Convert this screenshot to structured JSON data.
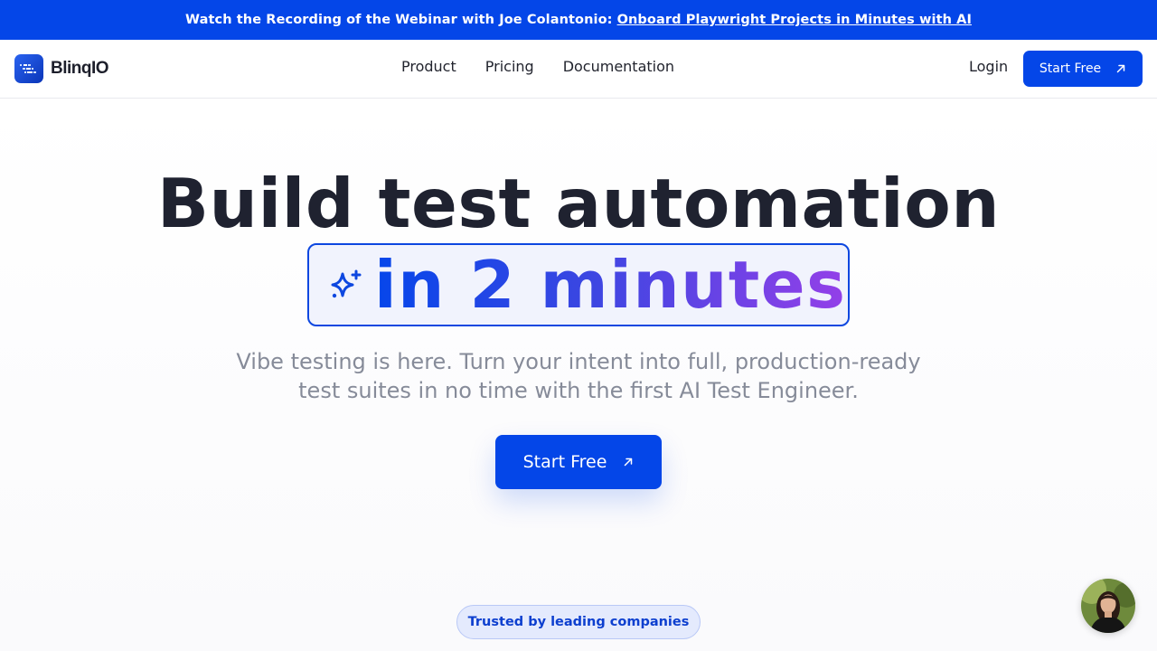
{
  "banner": {
    "text": "Watch the Recording of the Webinar with Joe Colantonio:",
    "link": "Onboard Playwright Projects in Minutes with AI"
  },
  "header": {
    "logo_text": "BlinqIO",
    "nav": [
      "Product",
      "Pricing",
      "Documentation"
    ],
    "login": "Login",
    "cta": "Start Free"
  },
  "hero": {
    "headline": "Build test automation",
    "highlight": "in 2 minutes",
    "subtitle_line1": "Vibe testing is here. Turn your intent into full, production-ready",
    "subtitle_line2": "test suites in no time with the first AI Test Engineer.",
    "cta": "Start Free"
  },
  "trusted": "Trusted by leading companies",
  "icons": {
    "banner_link": "external-link",
    "cta_arrow": "arrow-up-right-icon",
    "sparkle": "sparkle-icon",
    "chat": "chat-avatar"
  },
  "colors": {
    "brand": "#0446e8",
    "headline": "#1f2230",
    "gradient_start": "#0646ea",
    "gradient_end": "#9440e8",
    "subtitle": "#868b99"
  }
}
